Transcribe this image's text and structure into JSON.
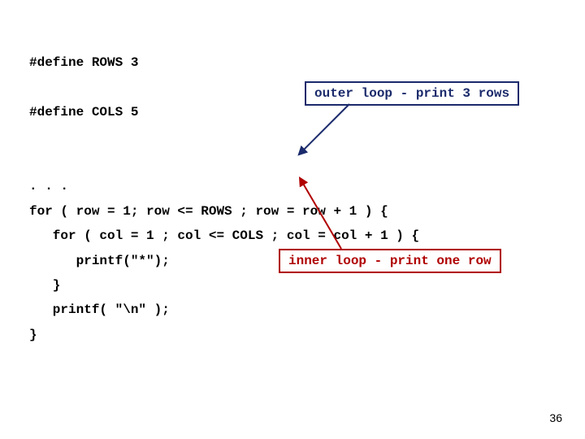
{
  "code": {
    "line1": "#define ROWS 3",
    "line2": "#define COLS 5",
    "line3": ". . .",
    "line4": "for ( row = 1; row <= ROWS ; row = row + 1 ) {",
    "line5": "   for ( col = 1 ; col <= COLS ; col = col + 1 ) {",
    "line6": "      printf(\"*\");",
    "line7": "   }",
    "line8": "   printf( \"\\n\" );",
    "line9": "}"
  },
  "annot": {
    "outer": "outer loop - print 3 rows",
    "inner": "inner loop - print one row"
  },
  "page_number": "36"
}
